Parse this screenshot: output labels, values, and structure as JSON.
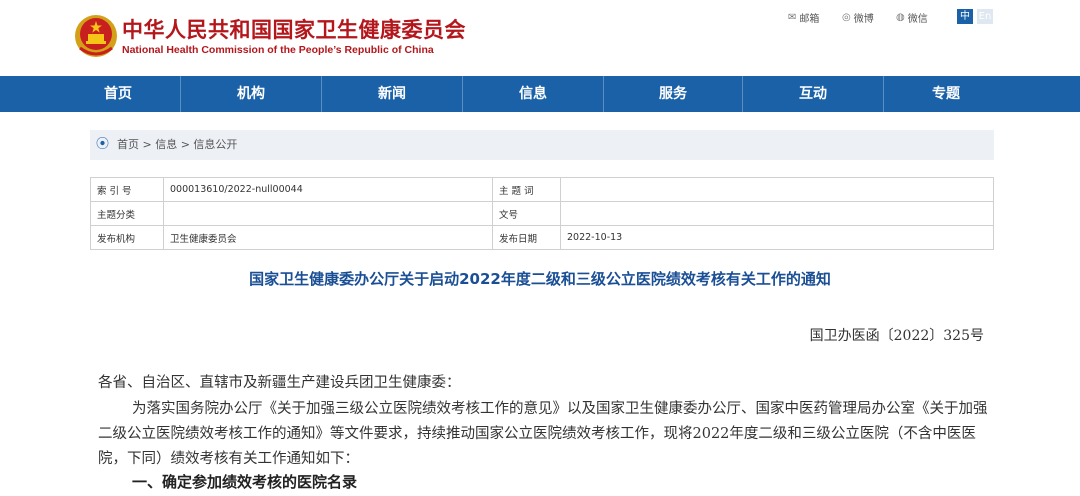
{
  "header": {
    "site_name_cn": "中华人民共和国国家卫生健康委员会",
    "site_name_en": "National Health Commission of the People’s Republic of China",
    "share": {
      "email": "邮箱",
      "weibo": "微博",
      "wechat": "微信"
    },
    "lang": {
      "zh": "中",
      "en": "En"
    }
  },
  "nav": [
    "首页",
    "机构",
    "新闻",
    "信息",
    "服务",
    "互动",
    "专题"
  ],
  "breadcrumb": "首页 > 信息 > 信息公开",
  "meta": {
    "index_label": "索 引 号",
    "index_value": "000013610/2022-null00044",
    "keyword_label": "主 题 词",
    "keyword_value": "",
    "category_label": "主题分类",
    "category_value": "",
    "docnum_label": "文号",
    "docnum_value": "",
    "publisher_label": "发布机构",
    "publisher_value": "卫生健康委员会",
    "date_label": "发布日期",
    "date_value": "2022-10-13"
  },
  "article": {
    "title": "国家卫生健康委办公厅关于启动2022年度二级和三级公立医院绩效考核有关工作的通知",
    "doc_number": "国卫办医函〔2022〕325号",
    "salutation": "各省、自治区、直辖市及新疆生产建设兵团卫生健康委：",
    "paragraph1": "为落实国务院办公厅《关于加强三级公立医院绩效考核工作的意见》以及国家卫生健康委办公厅、国家中医药管理局办公室《关于加强二级公立医院绩效考核工作的通知》等文件要求，持续推动国家公立医院绩效考核工作，现将2022年度二级和三级公立医院（不含中医医院，下同）绩效考核有关工作通知如下：",
    "heading1": "一、确定参加绩效考核的医院名录"
  },
  "colors": {
    "nav": "#1a61a8",
    "brand": "#b3171c",
    "title": "#1a4f95"
  }
}
